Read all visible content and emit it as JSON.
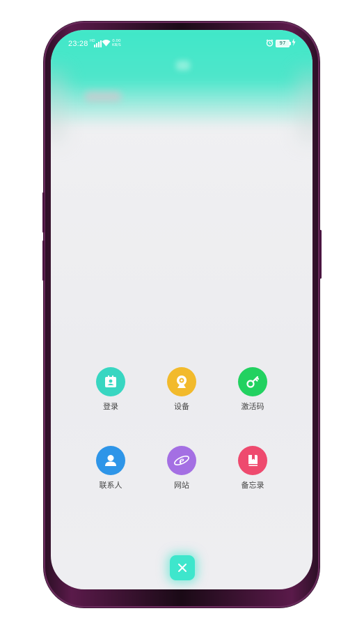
{
  "status_bar": {
    "time": "23:28",
    "network": "HD",
    "speed_value": "0.00",
    "speed_unit": "KB/S",
    "battery": "97"
  },
  "menu": {
    "items": [
      {
        "label": "登录",
        "icon": "login-icon",
        "color": "#38d6c1"
      },
      {
        "label": "设备",
        "icon": "camera-icon",
        "color": "#f2ba2c"
      },
      {
        "label": "激活码",
        "icon": "key-icon",
        "color": "#22d160"
      },
      {
        "label": "联系人",
        "icon": "contact-icon",
        "color": "#2e95e8"
      },
      {
        "label": "网站",
        "icon": "browser-icon",
        "color": "#a46fe3"
      },
      {
        "label": "备忘录",
        "icon": "notebook-icon",
        "color": "#ee4a6e"
      }
    ]
  },
  "colors": {
    "header_teal": "#3ee8c8",
    "close_button": "#3ee6cc"
  },
  "close_button": {
    "icon": "close-icon"
  }
}
